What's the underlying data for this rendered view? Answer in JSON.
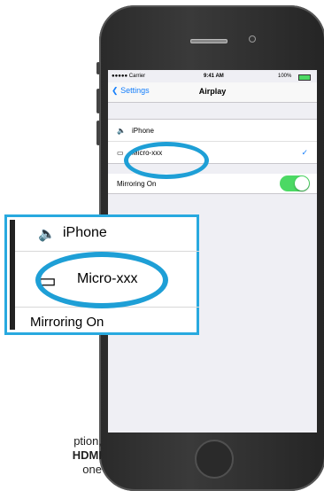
{
  "status": {
    "carrier": "●●●●● Carrier",
    "time": "9:41 AM",
    "battery": "100%"
  },
  "nav": {
    "back_label": "Settings",
    "title": "Airplay"
  },
  "devices": [
    {
      "icon": "speaker-icon",
      "label": "iPhone",
      "selected": false
    },
    {
      "icon": "airplay-icon",
      "label": "Micro-xxx",
      "selected": true
    }
  ],
  "mirroring": {
    "label": "Mirroring On",
    "enabled": true
  },
  "zoom": {
    "iphone_label": "iPhone",
    "micro_label": "Micro-xxx",
    "mirroring_label": "Mirroring On"
  },
  "caption": {
    "line1": "ption,",
    "line2": "HDMI",
    "line3": "one"
  },
  "colors": {
    "accent": "#147efb",
    "highlight": "#1e9fd6",
    "toggle_on": "#4cd964"
  }
}
